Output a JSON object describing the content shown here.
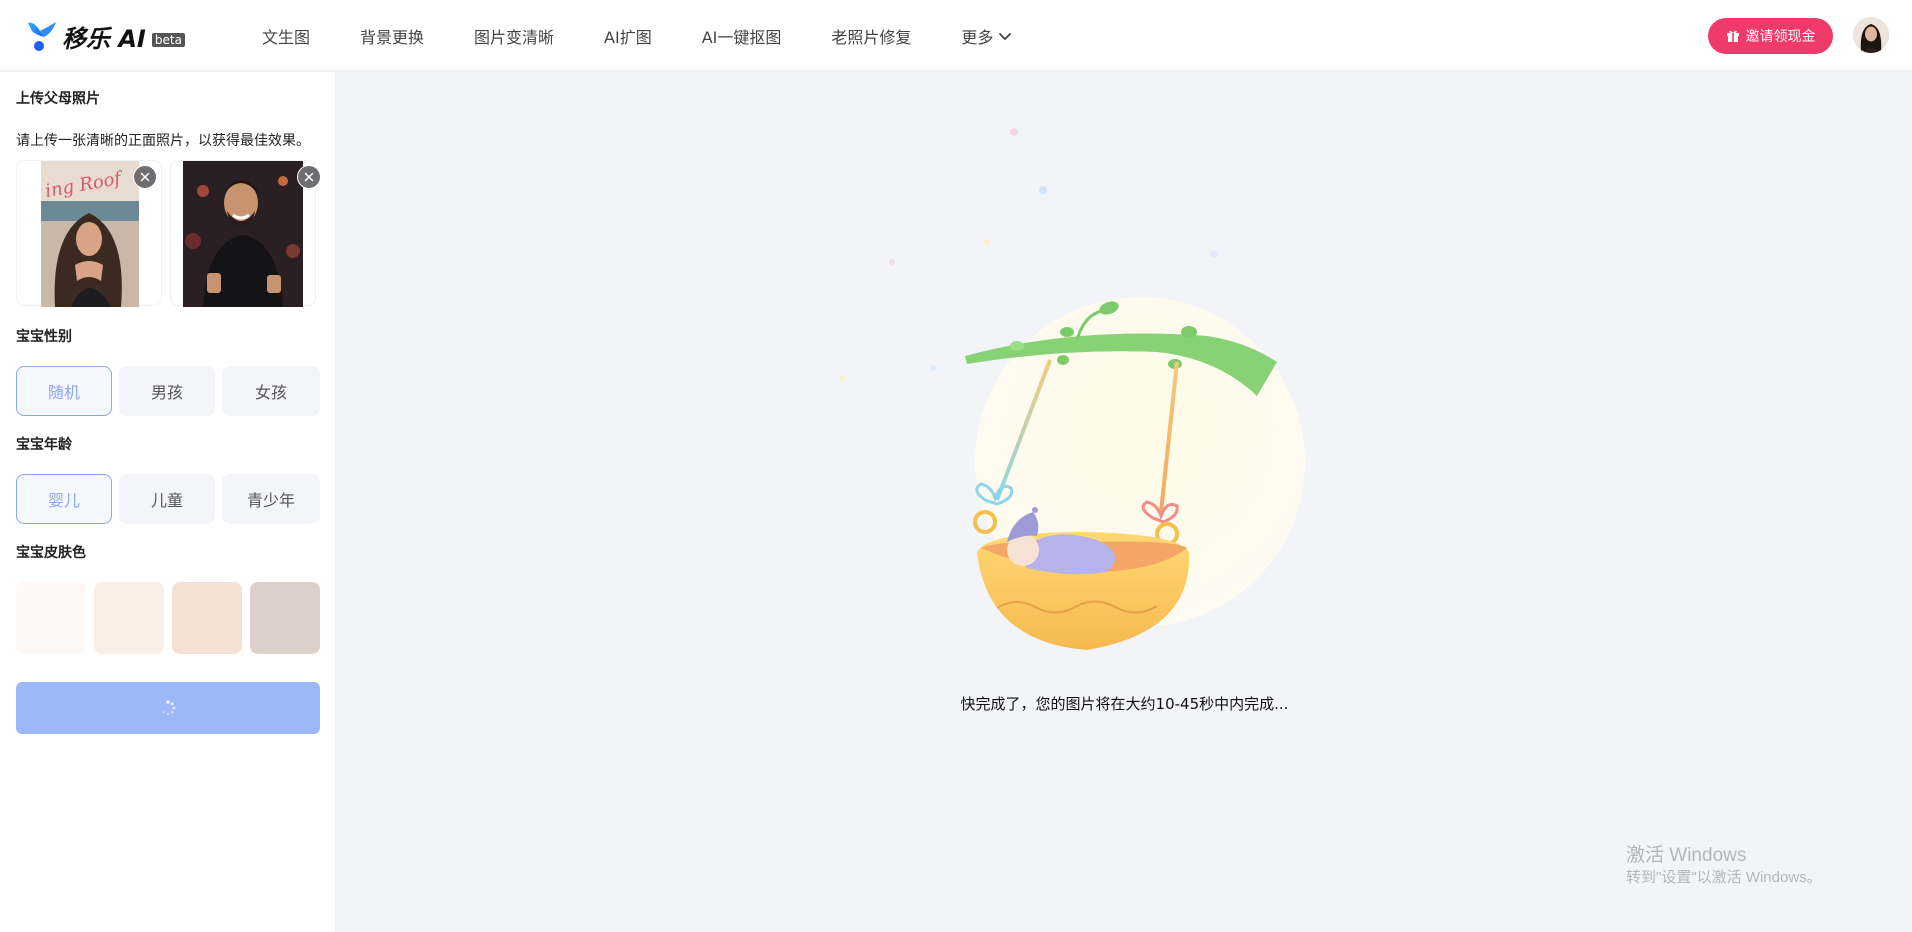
{
  "brand": {
    "name": "移乐 AI",
    "badge": "beta"
  },
  "nav": {
    "items": [
      "文生图",
      "背景更换",
      "图片变清晰",
      "AI扩图",
      "AI一键抠图",
      "老照片修复"
    ],
    "more": "更多"
  },
  "header": {
    "invite_label": "邀请领现金"
  },
  "sidebar": {
    "upload_title": "上传父母照片",
    "upload_hint": "请上传一张清晰的正面照片，以获得最佳效果。",
    "gender": {
      "title": "宝宝性别",
      "options": [
        "随机",
        "男孩",
        "女孩"
      ],
      "selected": "随机"
    },
    "age": {
      "title": "宝宝年龄",
      "options": [
        "婴儿",
        "儿童",
        "青少年"
      ],
      "selected": "婴儿"
    },
    "skin": {
      "title": "宝宝皮肤色",
      "colors": [
        "#fff8f4",
        "#fbeee6",
        "#f3e1d6",
        "#ddd0ca"
      ]
    },
    "generate_state": "loading"
  },
  "main": {
    "status_text": "快完成了，您的图片将在大约10-45秒中内完成..."
  },
  "watermark": {
    "line1": "激活 Windows",
    "line2": "转到\"设置\"以激活 Windows。"
  },
  "colors": {
    "accent": "#f03a6a",
    "primary": "#9db8f9",
    "selected_border": "#8aa8f5"
  }
}
